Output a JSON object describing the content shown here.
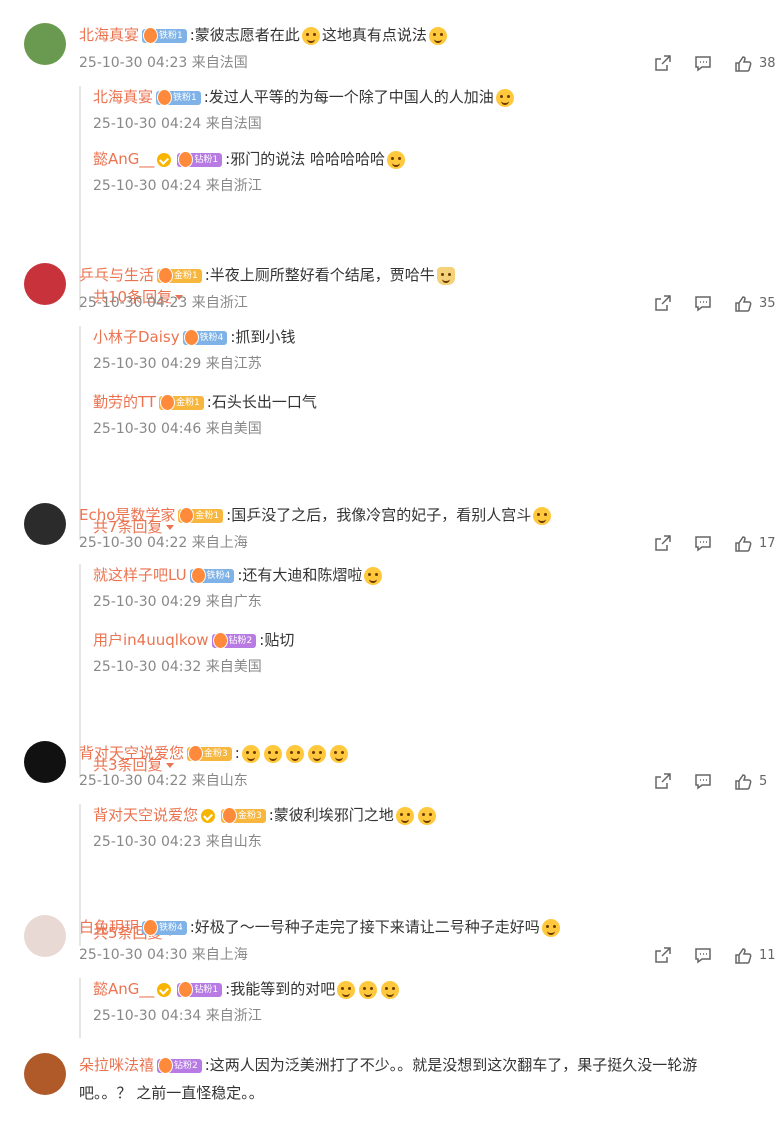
{
  "comments": [
    {
      "name": "北海真宴",
      "badge": "铁粉1",
      "badge_type": "iron",
      "verified": false,
      "text_parts": [
        ":蒙彼志愿者在此",
        "这地真有点说法",
        ""
      ],
      "emojis_after": [
        1,
        1,
        0
      ],
      "time": "25-10-30 04:23",
      "loc": "来自法国",
      "shares": "",
      "likes": "38",
      "replies": [
        {
          "name": "北海真宴",
          "badge": "铁粉1",
          "badge_type": "iron",
          "verified": false,
          "text": ":发过人平等的为每一个除了中国人的人加油",
          "emojis": 1,
          "time": "25-10-30 04:24",
          "loc": "来自法国"
        },
        {
          "name": "懿AnG__",
          "badge": "钻粉1",
          "badge_type": "diamond",
          "verified": true,
          "text": ":邪门的说法 哈哈哈哈哈",
          "emojis": 1,
          "time": "25-10-30 04:24",
          "loc": "来自浙江"
        }
      ],
      "more": "共10条回复",
      "avatar_color": "#6a9a4f"
    },
    {
      "name": "乒乓与生活",
      "badge": "金粉1",
      "badge_type": "gold",
      "verified": false,
      "text_parts": [
        ":半夜上厕所整好看个结尾，贾哈牛",
        "",
        ""
      ],
      "emojis_after": [
        1,
        0,
        0
      ],
      "time": "25-10-30 04:23",
      "loc": "来自浙江",
      "likes": "35",
      "replies": [
        {
          "name": "小林子Daisy",
          "badge": "铁粉4",
          "badge_type": "iron",
          "verified": false,
          "text": ":抓到小钱",
          "emojis": 0,
          "time": "25-10-30 04:29",
          "loc": "来自江苏"
        },
        {
          "name": "勤劳的TT",
          "badge": "金粉1",
          "badge_type": "gold",
          "verified": false,
          "text": ":石头长出一口气",
          "emojis": 0,
          "time": "25-10-30 04:46",
          "loc": "来自美国"
        }
      ],
      "more": "共7条回复",
      "avatar_color": "#c8323a"
    },
    {
      "name": "Echo是数学家",
      "badge": "金粉1",
      "badge_type": "gold",
      "verified": false,
      "text_parts": [
        ":国乒没了之后，我像冷宫的妃子，看别人宫斗",
        "",
        ""
      ],
      "emojis_after": [
        1,
        0,
        0
      ],
      "time": "25-10-30 04:22",
      "loc": "来自上海",
      "likes": "17",
      "replies": [
        {
          "name": "就这样子吧LU",
          "badge": "铁粉4",
          "badge_type": "iron",
          "verified": false,
          "text": ":还有大迪和陈熠啦",
          "emojis": 1,
          "time": "25-10-30 04:29",
          "loc": "来自广东"
        },
        {
          "name": "用户in4uuqlkow",
          "badge": "钻粉2",
          "badge_type": "diamond",
          "verified": false,
          "text": ":贴切",
          "emojis": 0,
          "time": "25-10-30 04:32",
          "loc": "来自美国"
        }
      ],
      "more": "共3条回复",
      "avatar_color": "#2b2b2b"
    },
    {
      "name": "背对天空说爱您",
      "badge": "金粉3",
      "badge_type": "gold",
      "verified": false,
      "text_parts": [
        ":",
        "",
        ""
      ],
      "emojis_after": [
        5,
        0,
        0
      ],
      "time": "25-10-30 04:22",
      "loc": "来自山东",
      "likes": "5",
      "replies": [
        {
          "name": "背对天空说爱您",
          "badge": "金粉3",
          "badge_type": "gold",
          "verified": true,
          "text": ":蒙彼利埃邪门之地",
          "emojis": 2,
          "time": "25-10-30 04:23",
          "loc": "来自山东"
        }
      ],
      "more": "共5条回复",
      "avatar_color": "#111111"
    },
    {
      "name": "白兔玥玥",
      "badge": "铁粉4",
      "badge_type": "iron",
      "verified": false,
      "text_parts": [
        ":好极了～一号种子走完了接下来请让二号种子走好吗",
        "",
        ""
      ],
      "emojis_after": [
        1,
        0,
        0
      ],
      "time": "25-10-30 04:30",
      "loc": "来自上海",
      "likes": "11",
      "replies": [
        {
          "name": "懿AnG__",
          "badge": "钻粉1",
          "badge_type": "diamond",
          "verified": true,
          "text": ":我能等到的对吧",
          "emojis": 3,
          "time": "25-10-30 04:34",
          "loc": "来自浙江"
        }
      ],
      "more": "",
      "avatar_color": "#e9d9d4"
    },
    {
      "name": "朵拉咪法禧",
      "badge": "钻粉2",
      "badge_type": "diamond",
      "verified": false,
      "text_parts": [
        ":这两人因为泛美洲打了不少。。就是没想到这次翻车了，果子挺久没一轮游",
        "",
        ""
      ],
      "text_line2": "吧。。？ 之前一直怪稳定。。",
      "emojis_after": [
        0,
        0,
        0
      ],
      "time": "",
      "loc": "",
      "likes": "",
      "replies": [],
      "more": "",
      "avatar_color": "#b05a2a"
    }
  ],
  "icons": {
    "share": "share-icon",
    "comment": "comment-icon",
    "like": "like-icon"
  }
}
